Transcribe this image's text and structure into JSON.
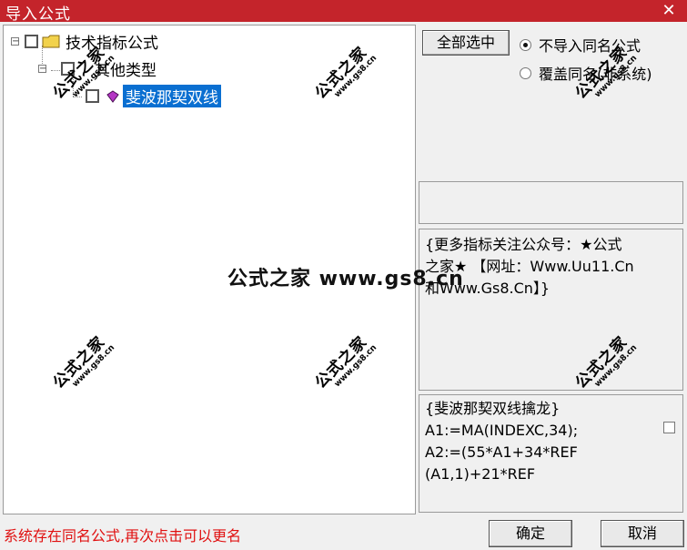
{
  "window": {
    "title": "导入公式",
    "close_glyph": "✕"
  },
  "tree": {
    "root": {
      "expander": "−",
      "label": "技术指标公式"
    },
    "child": {
      "expander": "−",
      "label": "其他类型"
    },
    "leaf": {
      "label": "斐波那契双线"
    }
  },
  "buttons": {
    "select_all": "全部选中",
    "ok": "确定",
    "cancel": "取消"
  },
  "options": {
    "no_import": "不导入同名公式",
    "overwrite": "覆盖同名(非系统)"
  },
  "info_panel": {
    "text": "{更多指标关注公众号：★公式\n之家★ 【网址：Www.Uu11.Cn\n和Www.Gs8.Cn】}"
  },
  "code_panel": {
    "text": "{斐波那契双线擒龙}\nA1:=MA(INDEXC,34);\nA2:=(55*A1+34*REF\n(A1,1)+21*REF"
  },
  "status": "系统存在同名公式,再次点击可以更名",
  "watermark": {
    "main": "公式之家",
    "sub": "www.gs8.cn",
    "center": "公式之家 www.gs8.cn"
  },
  "colors": {
    "titlebar": "#c4242b",
    "selection": "#0a6fd1",
    "status": "#e01010"
  }
}
